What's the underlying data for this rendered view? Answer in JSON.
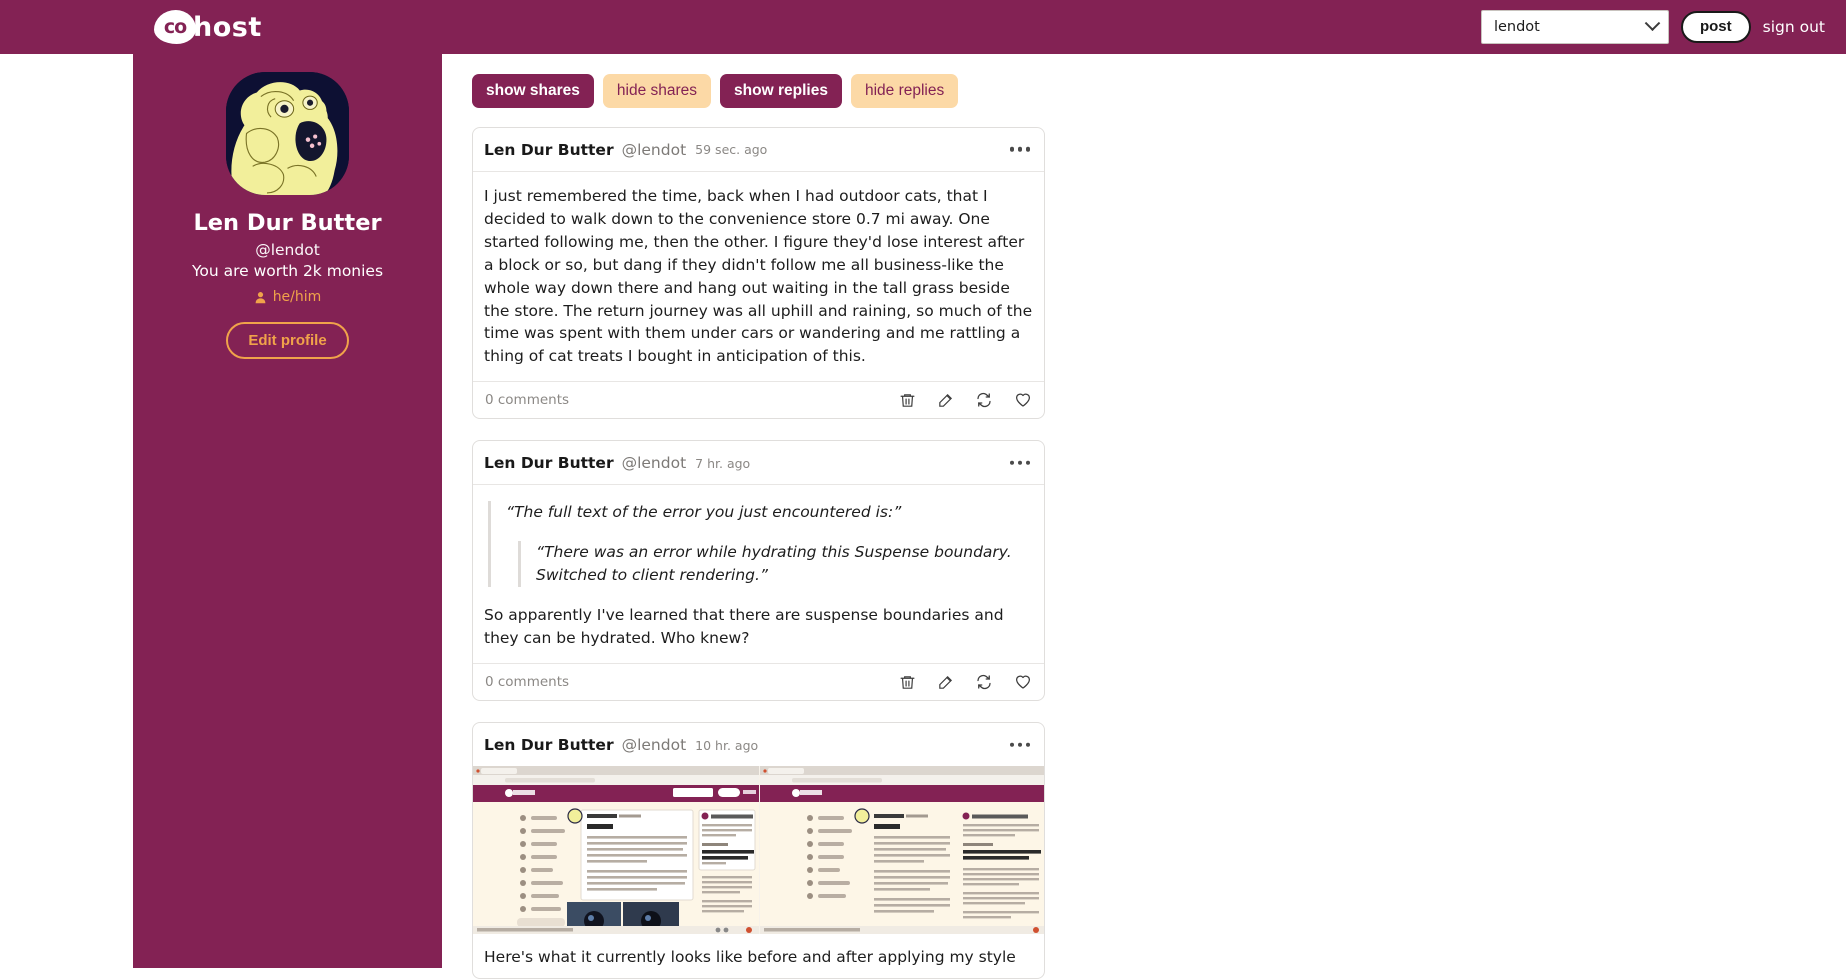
{
  "header": {
    "logo_mark": "co",
    "logo_word": "host",
    "account_value": "lendot",
    "account_chevron_icon": "chevron-down-icon",
    "post_label": "post",
    "signout_label": "sign out"
  },
  "sidebar": {
    "avatar_alt": "avatar-image",
    "display_name": "Len Dur Butter",
    "handle": "@lendot",
    "bio": "You are worth 2k monies",
    "pronouns": "he/him",
    "pronouns_icon": "person-icon",
    "edit_profile_label": "Edit profile"
  },
  "filters": [
    {
      "label": "show shares",
      "state": "active"
    },
    {
      "label": "hide shares",
      "state": "inactive"
    },
    {
      "label": "show replies",
      "state": "active"
    },
    {
      "label": "hide replies",
      "state": "inactive"
    }
  ],
  "posts": [
    {
      "author": "Len Dur Butter",
      "handle": "@lendot",
      "time": "59 sec. ago",
      "menu_icon": "more-options-icon",
      "body": "I just remembered the time, back when I had outdoor cats, that I decided to walk down to the convenience store 0.7 mi away. One started following me, then the other. I figure they'd lose interest after a block or so, but dang if they didn't follow me all business-like the whole way down there and hang out waiting in the tall grass beside the store. The return journey was all uphill and raining, so much of the time was spent with them under cars or wandering and me rattling a thing of cat treats I bought in anticipation of this.",
      "comments": "0 comments",
      "actions": [
        "delete-icon",
        "edit-icon",
        "share-icon",
        "like-icon"
      ]
    },
    {
      "author": "Len Dur Butter",
      "handle": "@lendot",
      "time": "7 hr. ago",
      "menu_icon": "more-options-icon",
      "quote_outer": "“The full text of the error you just encountered is:”",
      "quote_inner": "“There was an error while hydrating this Suspense boundary. Switched to client rendering.”",
      "body": "So apparently I've learned that there are suspense boundaries and they can be hydrated. Who knew?",
      "comments": "0 comments",
      "actions": [
        "delete-icon",
        "edit-icon",
        "share-icon",
        "like-icon"
      ]
    },
    {
      "author": "Len Dur Butter",
      "handle": "@lendot",
      "time": "10 hr. ago",
      "menu_icon": "more-options-icon",
      "image_alt": "screenshot-before-after-style",
      "caption": "Here's what it currently looks like before and after applying my style"
    }
  ],
  "colors": {
    "brand_maroon": "#832254",
    "accent_peach": "#fcd9a6",
    "accent_orange": "#f0a34a",
    "card_bg": "#ffffff"
  }
}
